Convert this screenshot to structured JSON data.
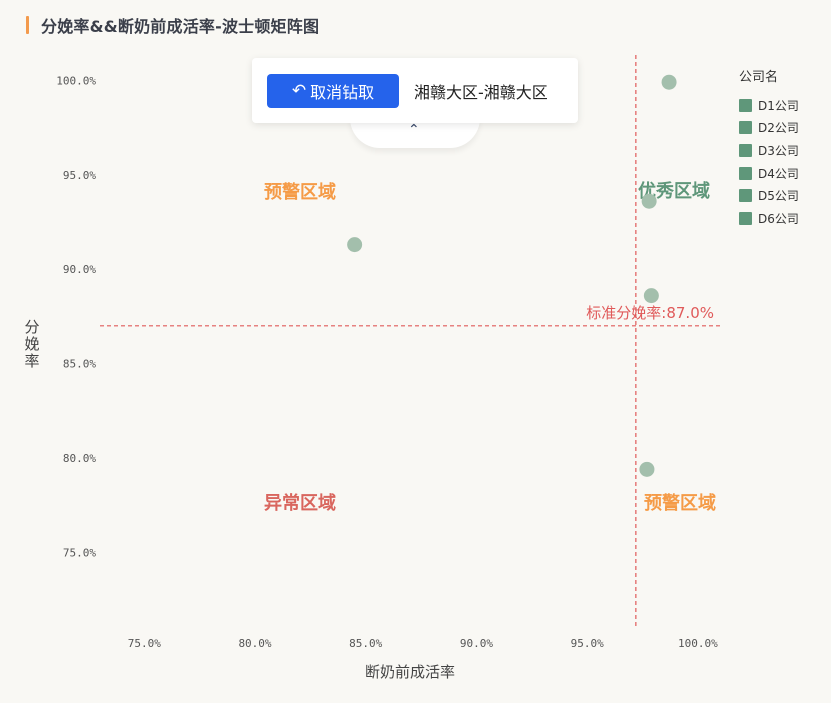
{
  "header": {
    "title": "分娩率&&断奶前成活率-波士顿矩阵图"
  },
  "popup": {
    "drill_back_label": "取消钻取",
    "drill_icon": "undo-icon",
    "region": "湘赣大区-湘赣大区",
    "collapse_icon": "chevron-up-icon"
  },
  "legend": {
    "title": "公司名",
    "items": [
      "D1公司",
      "D2公司",
      "D3公司",
      "D4公司",
      "D5公司",
      "D6公司"
    ]
  },
  "colors": {
    "point": "#a3bfac",
    "legend": "#5f977a",
    "axis_text": "#555555",
    "refline": "#e05a5a",
    "orange": "#f59b47",
    "green": "#5f977a",
    "red": "#d9665e",
    "accent": "#f39a4c",
    "button": "#2563eb"
  },
  "chart_data": {
    "type": "scatter",
    "title": "分娩率&&断奶前成活率-波士顿矩阵图",
    "xlabel": "断奶前成活率",
    "ylabel": "分娩率",
    "xlim": [
      73.0,
      101.0
    ],
    "ylim": [
      71.0,
      101.5
    ],
    "xticks": [
      75.0,
      80.0,
      85.0,
      90.0,
      95.0,
      100.0
    ],
    "yticks": [
      75.0,
      80.0,
      85.0,
      90.0,
      95.0,
      100.0
    ],
    "tick_suffix": "%",
    "grid": false,
    "legend_position": "right",
    "points": [
      {
        "x": 98.7,
        "y": 99.9
      },
      {
        "x": 97.8,
        "y": 93.6
      },
      {
        "x": 84.5,
        "y": 91.3
      },
      {
        "x": 97.9,
        "y": 88.6
      },
      {
        "x": 97.7,
        "y": 79.4
      }
    ],
    "ref_x": 97.2,
    "ref_y": 87.0,
    "ref_y_label": "标准分娩率:87.0%",
    "quadrants": {
      "top_left": "预警区域",
      "top_right": "优秀区域",
      "bottom_left": "异常区域",
      "bottom_right": "预警区域"
    }
  }
}
